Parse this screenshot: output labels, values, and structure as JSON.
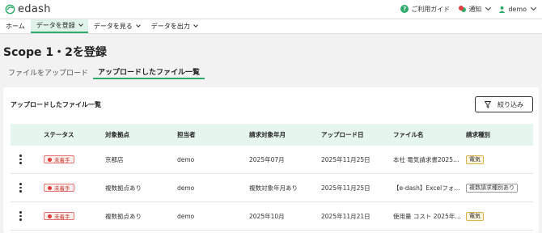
{
  "topbar": {
    "logo": "edash",
    "help_label": "ご利用ガイド",
    "notify_label": "通知",
    "user_label": "demo"
  },
  "nav": {
    "items": [
      {
        "label": "ホーム"
      },
      {
        "label": "データを登録"
      },
      {
        "label": "データを見る"
      },
      {
        "label": "データを出力"
      }
    ]
  },
  "page": {
    "title": "Scope 1・2を登録"
  },
  "tabs": [
    {
      "label": "ファイルをアップロード"
    },
    {
      "label": "アップロードしたファイル一覧"
    }
  ],
  "card": {
    "title": "アップロードしたファイル一覧",
    "filter_label": "絞り込み"
  },
  "table": {
    "headers": [
      "ステータス",
      "対象拠点",
      "担当者",
      "請求対象年月",
      "アップロード日",
      "ファイル名",
      "請求種別"
    ],
    "rows": [
      {
        "status": "未着手",
        "site": "京都店",
        "owner": "demo",
        "billing_month": "2025年07月",
        "upload_date": "2025年11月25日",
        "file_name": "本社 電気請求書2025…",
        "type": "電気",
        "type_kind": "elec"
      },
      {
        "status": "未着手",
        "site": "複数拠点あり",
        "owner": "demo",
        "billing_month": "複数対象年月あり",
        "upload_date": "2025年11月25日",
        "file_name": "【e-dash】Excelフォ…",
        "type": "複数請求種別あり",
        "type_kind": "multi"
      },
      {
        "status": "未着手",
        "site": "複数拠点あり",
        "owner": "demo",
        "billing_month": "2025年10月",
        "upload_date": "2025年11月21日",
        "file_name": "使用量 コスト 2025年…",
        "type": "電気",
        "type_kind": "elec"
      }
    ]
  },
  "colors": {
    "accent": "#2eaa6a",
    "status_red": "#e23b3b",
    "elec_tag": "#d9b24a"
  }
}
